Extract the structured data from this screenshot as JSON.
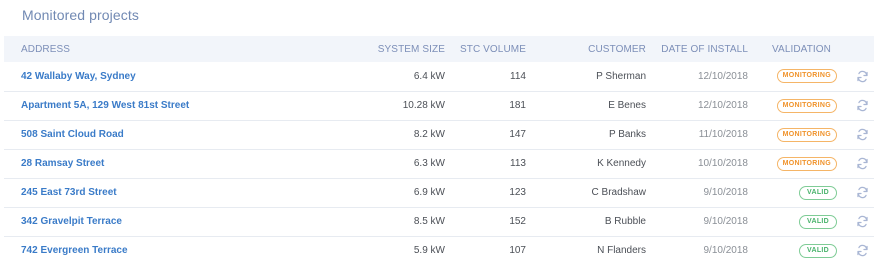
{
  "panel": {
    "title": "Monitored projects"
  },
  "columns": {
    "address": "ADDRESS",
    "system_size": "SYSTEM SIZE",
    "stc_volume": "STC VOLUME",
    "customer": "CUSTOMER",
    "date_of_install": "DATE OF INSTALL",
    "validation": "VALIDATION"
  },
  "status_colors": {
    "monitoring": "#f0932b",
    "valid": "#49b36c",
    "link": "#3a7bc8"
  },
  "rows": [
    {
      "address": "42 Wallaby Way, Sydney",
      "system_size": "6.4 kW",
      "stc_volume": "114",
      "customer": "P Sherman",
      "date_of_install": "12/10/2018",
      "validation": "MONITORING",
      "status": "monitoring",
      "action_icon": "refresh-icon"
    },
    {
      "address": "Apartment 5A, 129 West 81st Street",
      "system_size": "10.28 kW",
      "stc_volume": "181",
      "customer": "E Benes",
      "date_of_install": "12/10/2018",
      "validation": "MONITORING",
      "status": "monitoring",
      "action_icon": "refresh-icon"
    },
    {
      "address": "508 Saint Cloud Road",
      "system_size": "8.2 kW",
      "stc_volume": "147",
      "customer": "P Banks",
      "date_of_install": "11/10/2018",
      "validation": "MONITORING",
      "status": "monitoring",
      "action_icon": "refresh-icon"
    },
    {
      "address": "28 Ramsay Street",
      "system_size": "6.3 kW",
      "stc_volume": "113",
      "customer": "K Kennedy",
      "date_of_install": "10/10/2018",
      "validation": "MONITORING",
      "status": "monitoring",
      "action_icon": "refresh-icon"
    },
    {
      "address": "245 East 73rd Street",
      "system_size": "6.9 kW",
      "stc_volume": "123",
      "customer": "C Bradshaw",
      "date_of_install": "9/10/2018",
      "validation": "VALID",
      "status": "valid",
      "action_icon": "refresh-icon"
    },
    {
      "address": "342 Gravelpit Terrace",
      "system_size": "8.5 kW",
      "stc_volume": "152",
      "customer": "B Rubble",
      "date_of_install": "9/10/2018",
      "validation": "VALID",
      "status": "valid",
      "action_icon": "refresh-icon"
    },
    {
      "address": "742 Evergreen Terrace",
      "system_size": "5.9 kW",
      "stc_volume": "107",
      "customer": "N Flanders",
      "date_of_install": "9/10/2018",
      "validation": "VALID",
      "status": "valid",
      "action_icon": "refresh-icon"
    }
  ]
}
